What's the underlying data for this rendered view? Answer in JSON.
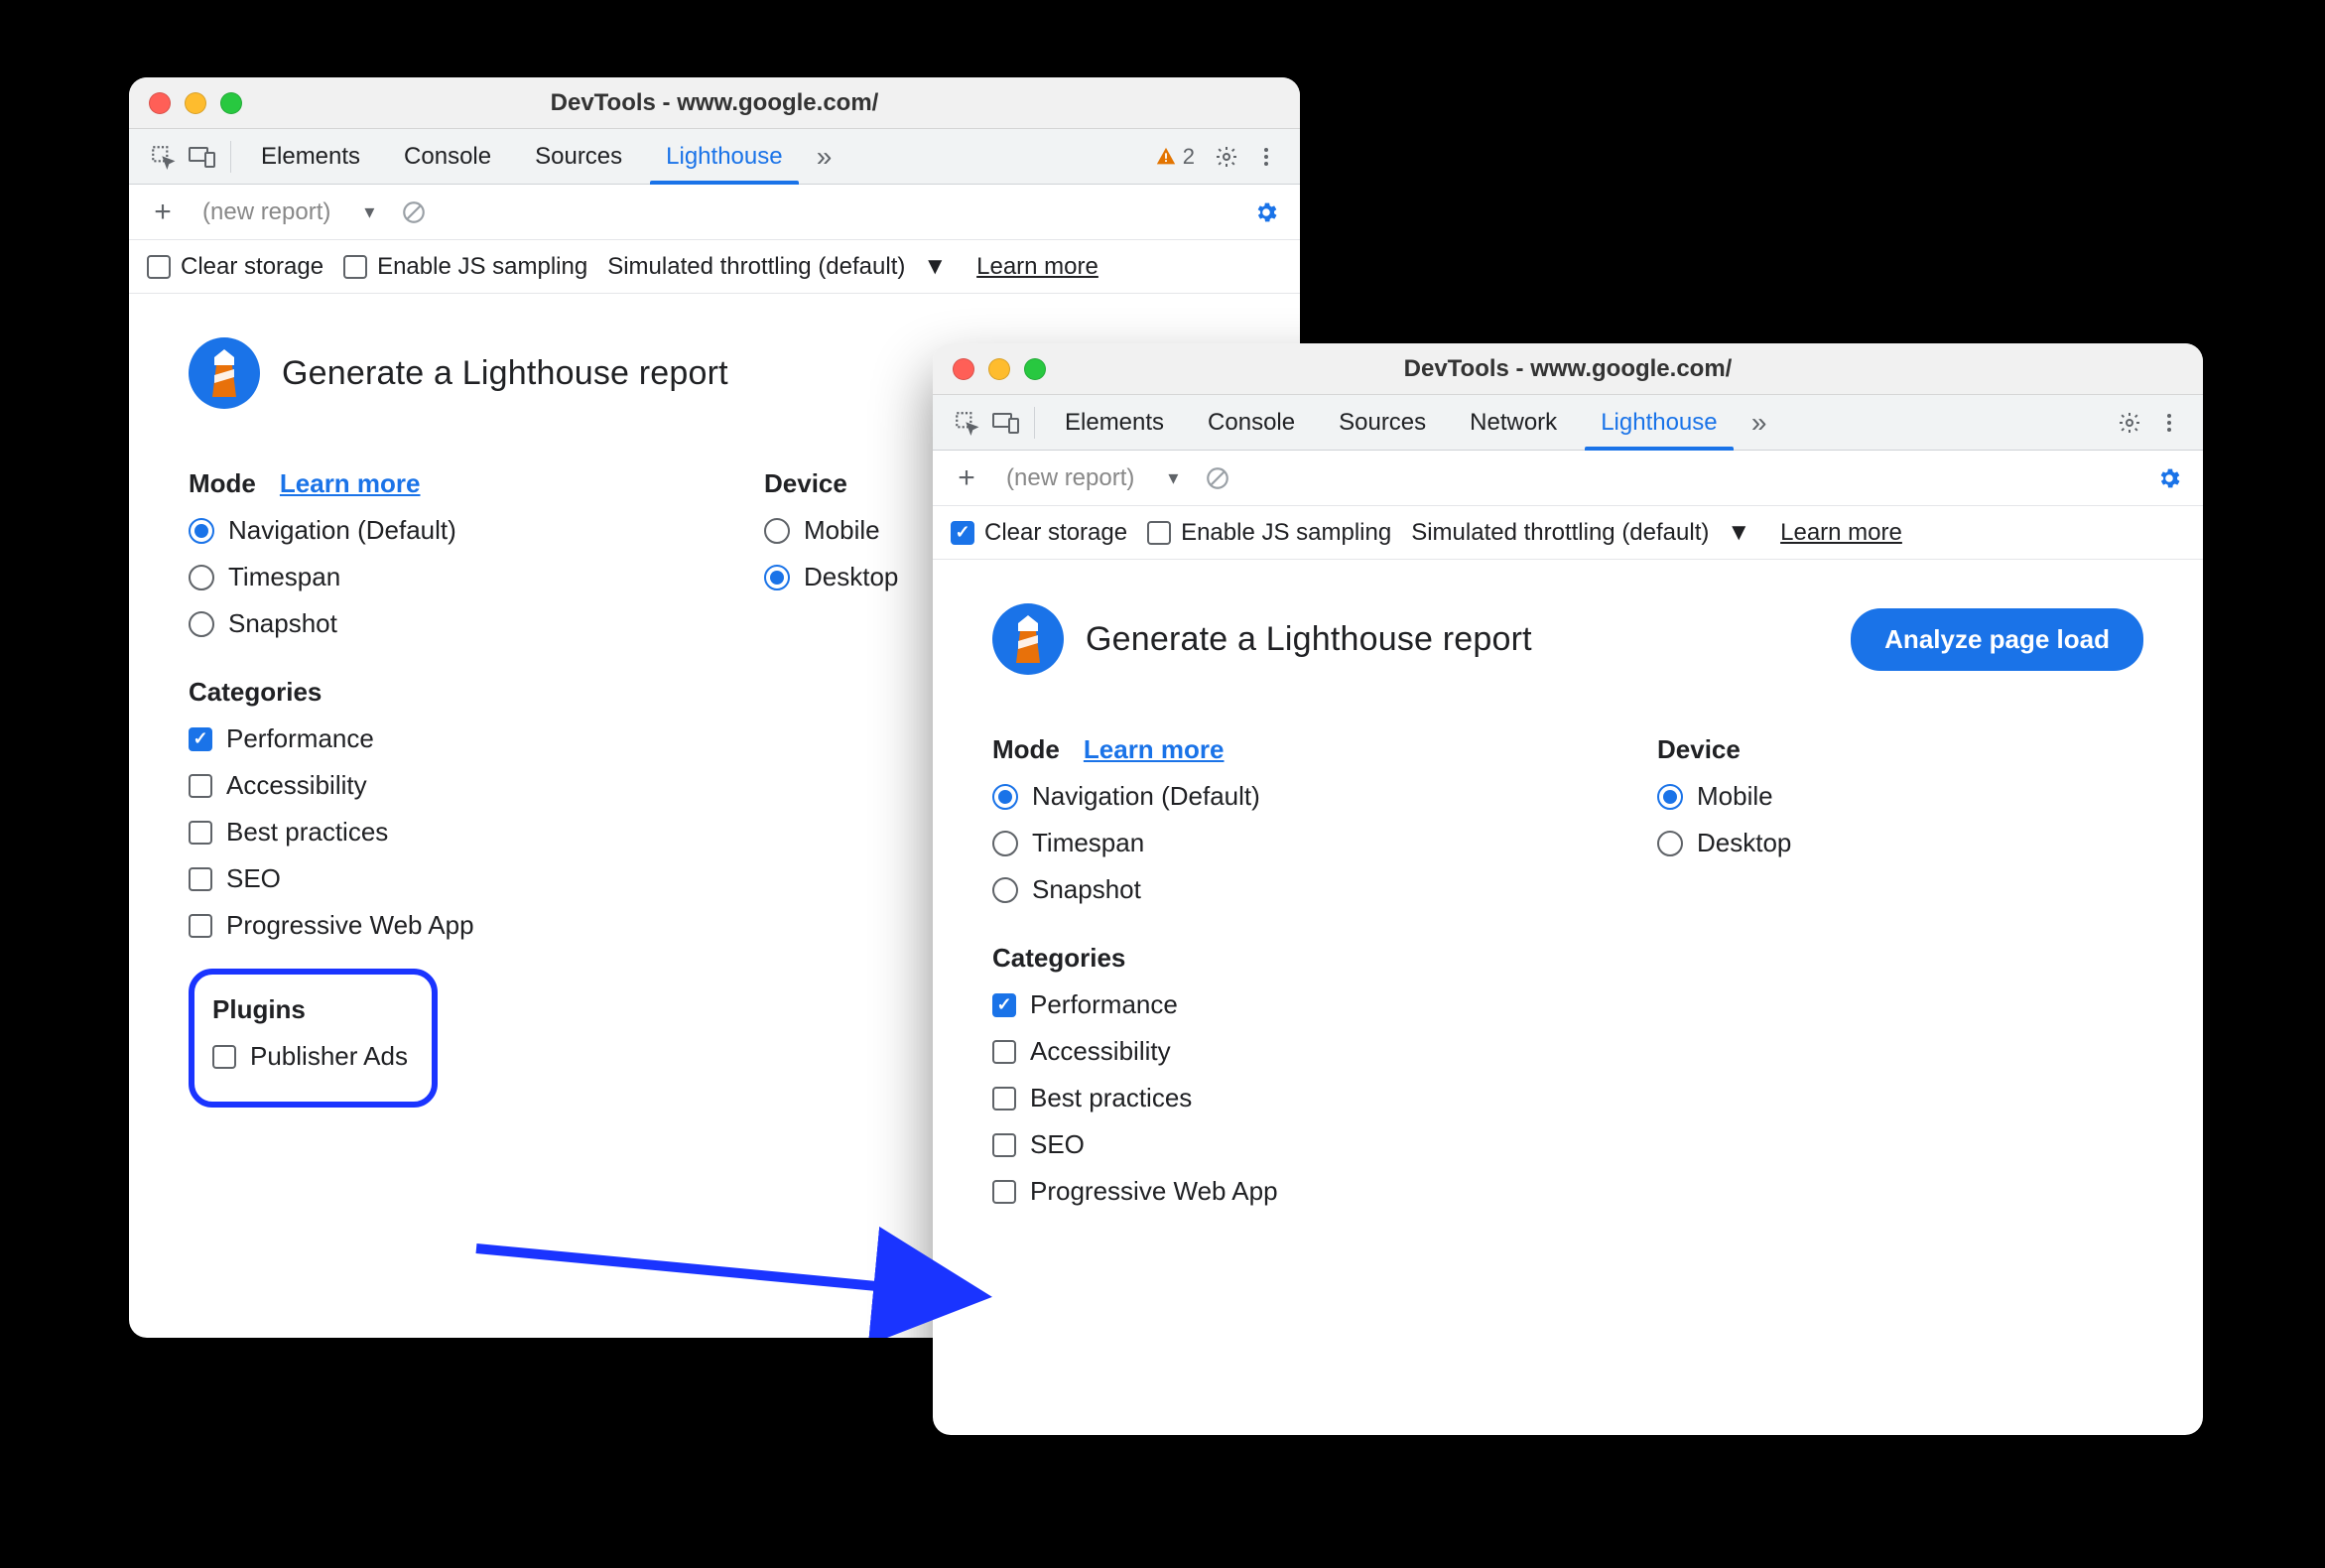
{
  "window_a": {
    "title": "DevTools - www.google.com/",
    "tabs": [
      "Elements",
      "Console",
      "Sources",
      "Lighthouse"
    ],
    "active_tab": 3,
    "warn_count": "2",
    "secondbar_placeholder": "(new report)",
    "options_row": {
      "clear_storage": "Clear storage",
      "enable_js": "Enable JS sampling",
      "throttling": "Simulated throttling (default)",
      "learn_more": "Learn more"
    },
    "header": "Generate a Lighthouse report",
    "mode_label": "Mode",
    "mode_learn_more": "Learn more",
    "modes": [
      "Navigation (Default)",
      "Timespan",
      "Snapshot"
    ],
    "mode_selected": 0,
    "device_label": "Device",
    "devices": [
      "Mobile",
      "Desktop"
    ],
    "device_selected": 1,
    "categories_label": "Categories",
    "categories": [
      "Performance",
      "Accessibility",
      "Best practices",
      "SEO",
      "Progressive Web App"
    ],
    "categories_checked": [
      true,
      false,
      false,
      false,
      false
    ],
    "plugins_label": "Plugins",
    "plugins": [
      "Publisher Ads"
    ]
  },
  "window_b": {
    "title": "DevTools - www.google.com/",
    "tabs": [
      "Elements",
      "Console",
      "Sources",
      "Network",
      "Lighthouse"
    ],
    "active_tab": 4,
    "secondbar_placeholder": "(new report)",
    "options_row": {
      "clear_storage": "Clear storage",
      "clear_storage_checked": true,
      "enable_js": "Enable JS sampling",
      "throttling": "Simulated throttling (default)",
      "learn_more": "Learn more"
    },
    "header": "Generate a Lighthouse report",
    "cta": "Analyze page load",
    "mode_label": "Mode",
    "mode_learn_more": "Learn more",
    "modes": [
      "Navigation (Default)",
      "Timespan",
      "Snapshot"
    ],
    "mode_selected": 0,
    "device_label": "Device",
    "devices": [
      "Mobile",
      "Desktop"
    ],
    "device_selected": 0,
    "categories_label": "Categories",
    "categories": [
      "Performance",
      "Accessibility",
      "Best practices",
      "SEO",
      "Progressive Web App"
    ],
    "categories_checked": [
      true,
      false,
      false,
      false,
      false
    ]
  }
}
